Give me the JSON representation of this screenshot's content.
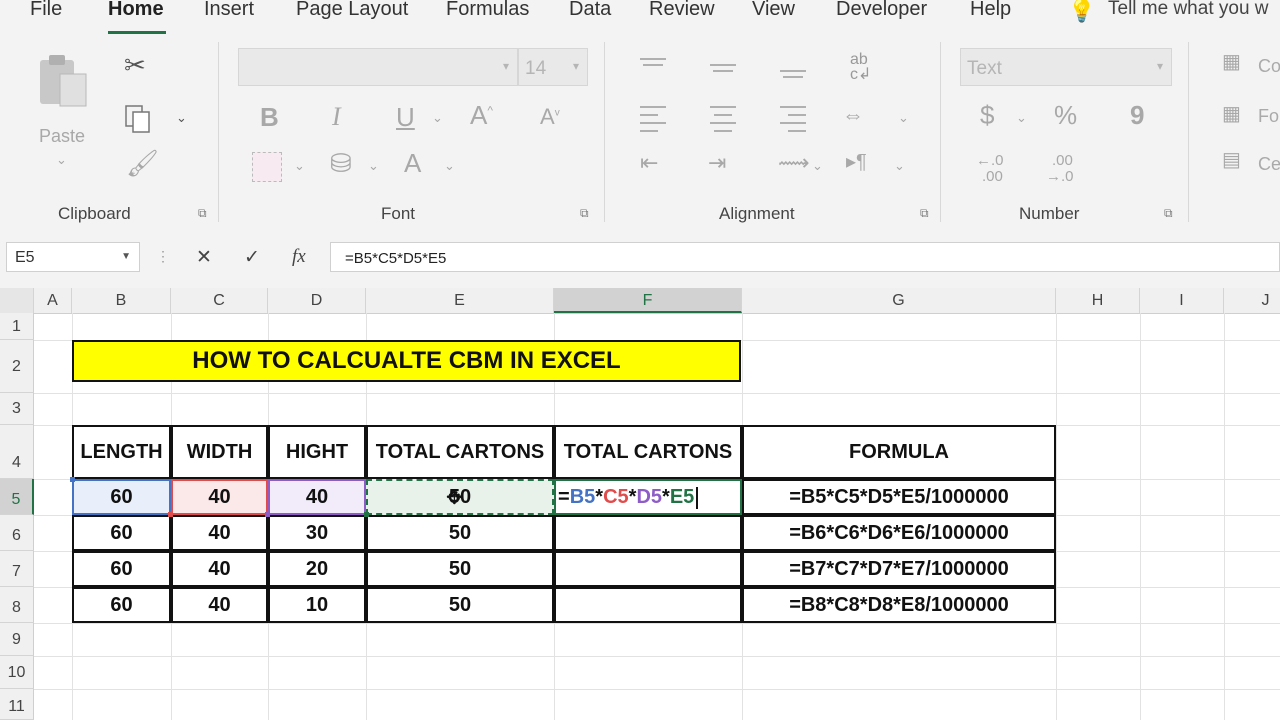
{
  "tabs": [
    "File",
    "Home",
    "Insert",
    "Page Layout",
    "Formulas",
    "Data",
    "Review",
    "View",
    "Developer",
    "Help"
  ],
  "tell_me": "Tell me what you w",
  "ribbon": {
    "clipboard": {
      "label": "Clipboard",
      "paste": "Paste"
    },
    "font": {
      "label": "Font",
      "size": "14",
      "bold": "B",
      "italic": "I",
      "underline": "U"
    },
    "alignment": {
      "label": "Alignment"
    },
    "number": {
      "label": "Number",
      "format": "Text",
      "currency": "$",
      "percent": "%",
      "comma": "9",
      "inc_decimal_top": "←.0",
      "inc_decimal_bottom": ".00",
      "dec_decimal_top": ".00",
      "dec_decimal_bottom": "→.0"
    },
    "styles_partial": [
      "Co",
      "Fo",
      "Ce"
    ]
  },
  "formula_bar": {
    "name_box": "E5",
    "cancel": "✕",
    "enter": "✓",
    "fx": "fx",
    "formula": "=B5*C5*D5*E5"
  },
  "columns": [
    "A",
    "B",
    "C",
    "D",
    "E",
    "F",
    "G",
    "H",
    "I",
    "J"
  ],
  "rows": [
    "1",
    "2",
    "3",
    "4",
    "5",
    "6",
    "7",
    "8",
    "9",
    "10",
    "11"
  ],
  "sheet": {
    "title": "HOW TO CALCUALTE CBM IN EXCEL",
    "headers": [
      "LENGTH",
      "WIDTH",
      "HIGHT",
      "TOTAL CARTONS",
      "TOTAL CARTONS",
      "FORMULA"
    ],
    "rows": [
      {
        "b": "60",
        "c": "40",
        "d": "40",
        "e": "50",
        "f": "",
        "g": "=B5*C5*D5*E5/1000000"
      },
      {
        "b": "60",
        "c": "40",
        "d": "30",
        "e": "50",
        "f": "",
        "g": "=B6*C6*D6*E6/1000000"
      },
      {
        "b": "60",
        "c": "40",
        "d": "20",
        "e": "50",
        "f": "",
        "g": "=B7*C7*D7*E7/1000000"
      },
      {
        "b": "60",
        "c": "40",
        "d": "10",
        "e": "50",
        "f": "",
        "g": "=B8*C8*D8*E8/1000000"
      }
    ],
    "editing": {
      "eq": "=",
      "b": "B5",
      "s1": "*",
      "c": "C5",
      "s2": "*",
      "d": "D5",
      "s3": "*",
      "e": "E5"
    }
  },
  "colors": {
    "accent": "#217346",
    "title_fill": "#ffff00",
    "ref_b": "#4472c4",
    "ref_c": "#e04b4b",
    "ref_d": "#8e5cc7",
    "ref_e": "#217346"
  }
}
